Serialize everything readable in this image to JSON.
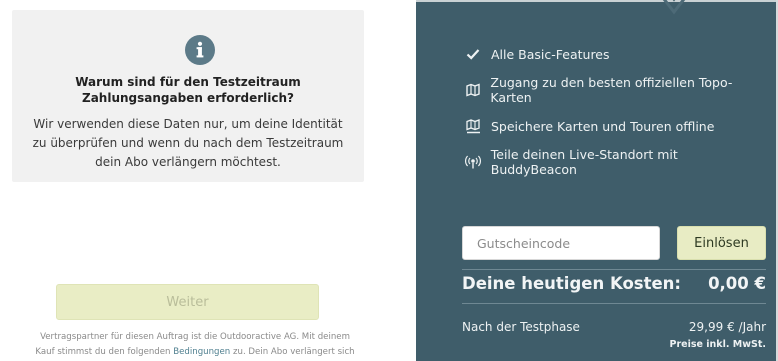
{
  "info_card": {
    "icon": "info-icon",
    "title_line1": "Warum sind für den Testzeitraum",
    "title_line2": "Zahlungsangaben erforderlich?",
    "text_line1": "Wir verwenden diese Daten nur, um deine Identität",
    "text_line2": "zu überprüfen und wenn du nach dem Testzeitraum",
    "text_line3": "dein Abo verlängern möchtest."
  },
  "next_button": {
    "label": "Weiter"
  },
  "legal": {
    "line1": "Vertragspartner für diesen Auftrag ist die Outdooractive AG. Mit deinem",
    "line2_before": "Kauf stimmst du den folgenden ",
    "line2_link": "Bedingungen",
    "line2_after": " zu. Dein Abo verlängert sich"
  },
  "features": [
    {
      "icon": "checkmark-icon",
      "label": "Alle Basic-Features"
    },
    {
      "icon": "map-icon",
      "label": "Zugang zu den besten offiziellen Topo-Karten"
    },
    {
      "icon": "offline-map-icon",
      "label": "Speichere Karten und Touren offline"
    },
    {
      "icon": "live-location-icon",
      "label": "Teile deinen Live-Standort mit BuddyBeacon"
    }
  ],
  "voucher": {
    "placeholder": "Gutscheincode",
    "value": "",
    "redeem_label": "Einlösen"
  },
  "summary": {
    "cost_label": "Deine heutigen Kosten:",
    "cost_value": "0,00 €",
    "after_label": "Nach der Testphase",
    "after_value": "29,99 € /Jahr",
    "vat_note": "Preise inkl. MwSt."
  },
  "colors": {
    "panel_bg": "#3f5d6a",
    "button_bg": "#e8ecc4",
    "info_card_bg": "#f1f1f1",
    "link": "#4f7f8f"
  }
}
